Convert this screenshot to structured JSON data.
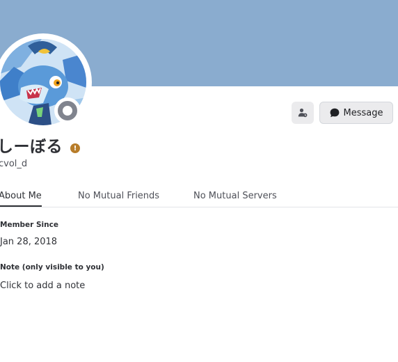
{
  "profile": {
    "display_name": "しーぼる",
    "username": "cvol_d",
    "status": "offline",
    "avatar_icon": "avatar-shark-character"
  },
  "badge": {
    "icon": "warning-badge-icon",
    "symbol": "!",
    "color": "#b87d2a"
  },
  "banner": {
    "color": "#8aaccf"
  },
  "actions": {
    "friend_icon": "add-friend-icon",
    "message_label": "Message",
    "message_icon": "chat-bubble-icon"
  },
  "tabs": [
    {
      "label": "About Me",
      "active": true
    },
    {
      "label": "No Mutual Friends",
      "active": false
    },
    {
      "label": "No Mutual Servers",
      "active": false
    }
  ],
  "about": {
    "member_since_label": "Member Since",
    "member_since_value": "Jan 28, 2018",
    "note_label": "Note (only visible to you)",
    "note_placeholder": "Click to add a note"
  }
}
